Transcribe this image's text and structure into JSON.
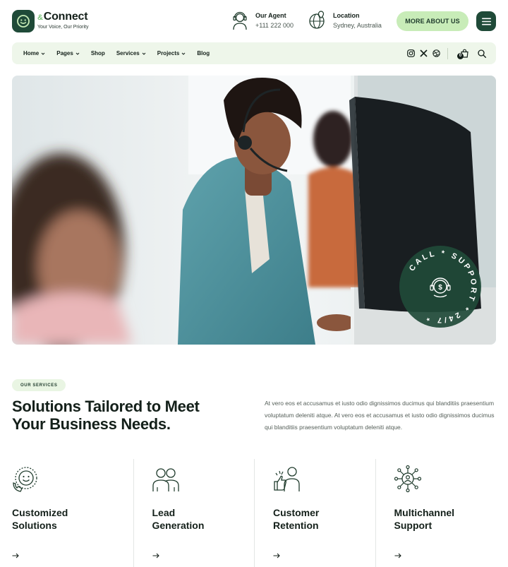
{
  "brand": {
    "name": "Connect",
    "name_prefix": "&",
    "tagline": "Your Voice, Our Priority",
    "color_primary": "#1f4a38",
    "color_accent": "#c8ecb8"
  },
  "header": {
    "agent": {
      "label": "Our Agent",
      "value": "+111 222 000",
      "icon": "headset-agent-icon"
    },
    "location": {
      "label": "Location",
      "value": "Sydney, Australia",
      "icon": "globe-pin-icon"
    },
    "about_button": "MORE ABOUT US",
    "menu_icon": "hamburger-icon"
  },
  "nav": {
    "items": [
      {
        "label": "Home",
        "dropdown": true
      },
      {
        "label": "Pages",
        "dropdown": true
      },
      {
        "label": "Shop",
        "dropdown": false
      },
      {
        "label": "Services",
        "dropdown": true
      },
      {
        "label": "Projects",
        "dropdown": true
      },
      {
        "label": "Blog",
        "dropdown": false
      }
    ],
    "social": [
      "instagram-icon",
      "x-icon",
      "dribbble-icon"
    ],
    "cart_count": "0",
    "cart_icon": "shopping-bag-icon",
    "search_icon": "search-icon"
  },
  "hero": {
    "badge_text": "CALL * SUPPORT * 24/7 *",
    "badge_icon": "headset-dollar-icon"
  },
  "services": {
    "tag": "OUR SERVICES",
    "heading_line1": "Solutions Tailored to Meet",
    "heading_line2": "Your Business Needs.",
    "paragraph": "At vero eos et accusamus et iusto odio dignissimos ducimus qui blanditiis praesentium voluptatum deleniti atque. At vero eos et accusamus et iusto odio dignissimos ducimus qui blanditiis praesentium voluptatum deleniti atque.",
    "cards": [
      {
        "title_line1": "Customized",
        "title_line2": "Solutions",
        "icon": "smile-phone-icon"
      },
      {
        "title_line1": "Lead",
        "title_line2": "Generation",
        "icon": "two-users-icon"
      },
      {
        "title_line1": "Customer",
        "title_line2": "Retention",
        "icon": "thumbs-up-user-icon"
      },
      {
        "title_line1": "Multichannel",
        "title_line2": "Support",
        "icon": "network-user-icon"
      }
    ]
  }
}
